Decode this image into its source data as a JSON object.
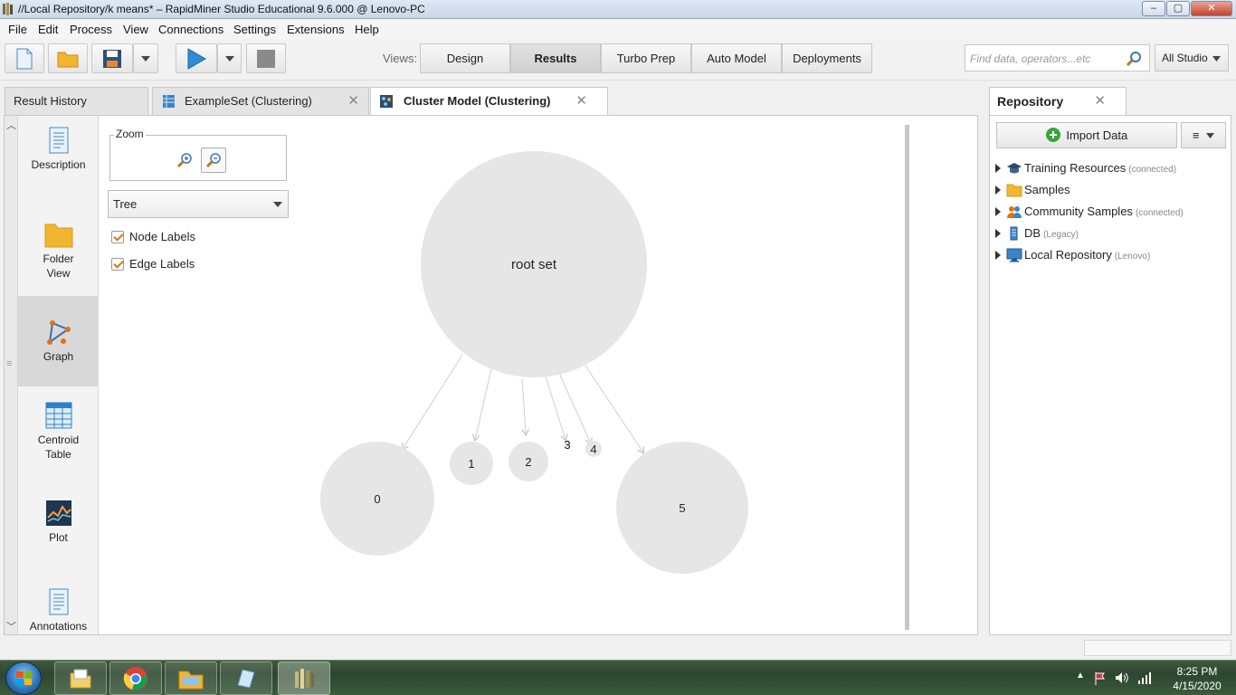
{
  "window": {
    "title": "//Local Repository/k means* – RapidMiner Studio Educational 9.6.000 @ Lenovo-PC"
  },
  "menu": [
    "File",
    "Edit",
    "Process",
    "View",
    "Connections",
    "Settings",
    "Extensions",
    "Help"
  ],
  "toolbar": {
    "views_label": "Views:",
    "views": [
      "Design",
      "Results",
      "Turbo Prep",
      "Auto Model",
      "Deployments"
    ],
    "active_view": "Results",
    "search_placeholder": "Find data, operators...etc",
    "studio_label": "All Studio"
  },
  "tabs": {
    "result_history": "Result History",
    "example_set": "ExampleSet (Clustering)",
    "cluster_model": "Cluster Model (Clustering)"
  },
  "sidenav": {
    "description": "Description",
    "folder_view_1": "Folder",
    "folder_view_2": "View",
    "graph": "Graph",
    "centroid_table_1": "Centroid",
    "centroid_table_2": "Table",
    "plot": "Plot",
    "annotations": "Annotations"
  },
  "controls": {
    "zoom_label": "Zoom",
    "layout_value": "Tree",
    "node_labels": "Node Labels",
    "edge_labels": "Edge Labels",
    "node_labels_checked": true,
    "edge_labels_checked": true
  },
  "graph": {
    "root_label": "root set",
    "clusters": [
      "0",
      "1",
      "2",
      "3",
      "4",
      "5"
    ]
  },
  "repository": {
    "tab_label": "Repository",
    "import_label": "Import Data",
    "menu_label": "≡",
    "items": [
      {
        "name": "Training Resources",
        "status": "(connected)"
      },
      {
        "name": "Samples",
        "status": ""
      },
      {
        "name": "Community Samples",
        "status": "(connected)"
      },
      {
        "name": "DB",
        "status": "(Legacy)"
      },
      {
        "name": "Local Repository",
        "status": "(Lenovo)"
      }
    ]
  },
  "taskbar": {
    "time": "8:25 PM",
    "date": "4/15/2020"
  },
  "colors": {
    "accent_orange": "#e27214",
    "node_fill": "#e6e6e6",
    "run_blue": "#2f8ad8"
  }
}
